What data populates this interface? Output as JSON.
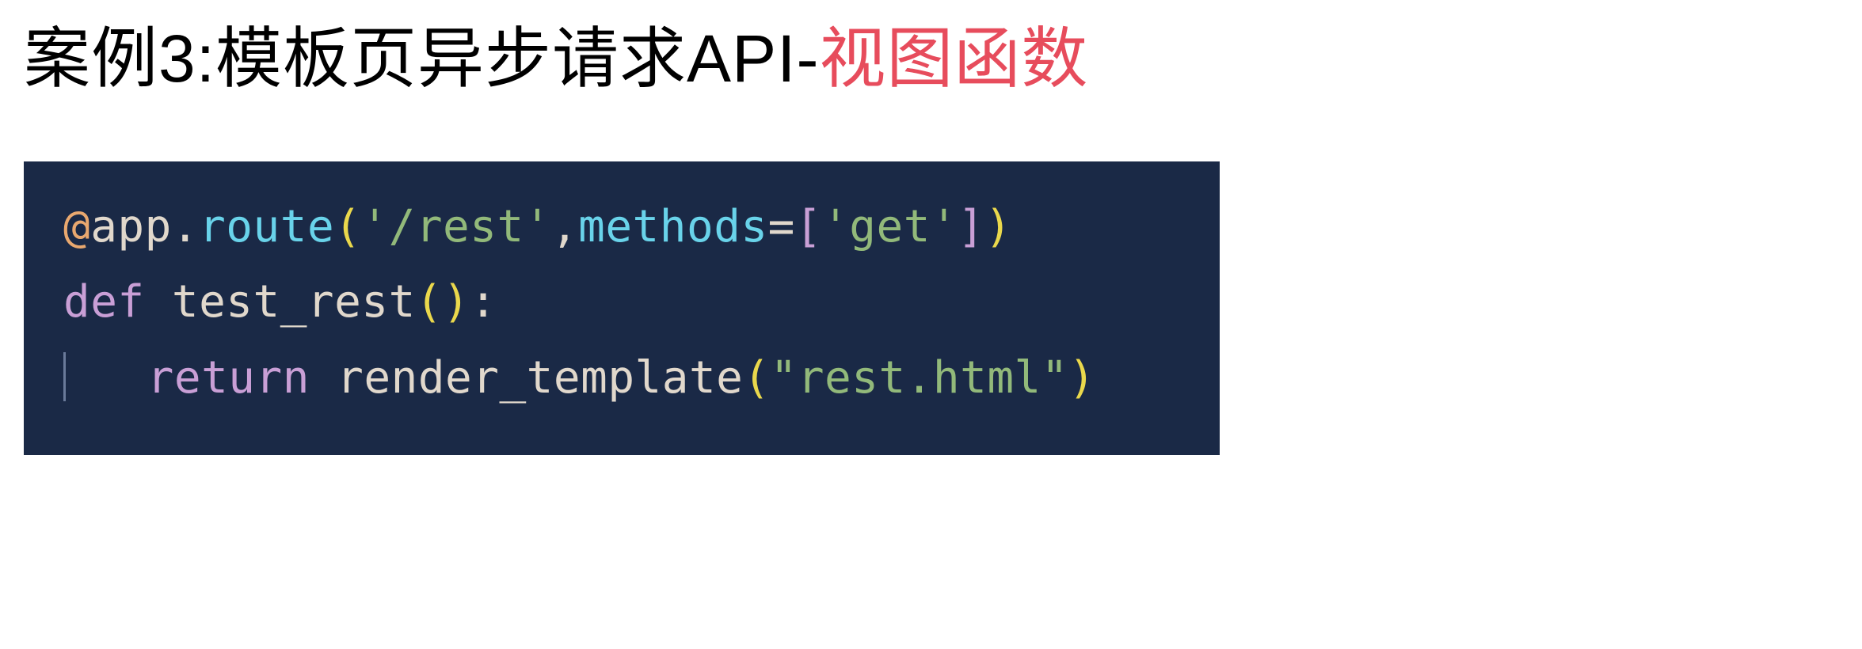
{
  "heading": {
    "prefix": "案例3:模板页异步请求API-",
    "highlight": "视图函数"
  },
  "code": {
    "line1": {
      "at": "@",
      "app": "app",
      "dot": ".",
      "route": "route",
      "lparen": "(",
      "path": "'/rest'",
      "comma": ",",
      "methods_kw": "methods",
      "equals": "=",
      "lbracket": "[",
      "method_val": "'get'",
      "rbracket": "]",
      "rparen": ")"
    },
    "line2": {
      "def": "def ",
      "name": "test_rest",
      "parens": "()",
      "colon": ":"
    },
    "line3": {
      "indent_spaces": "   ",
      "ret": "return ",
      "func": "render_template",
      "lparen": "(",
      "arg": "\"rest.html\"",
      "rparen": ")"
    }
  }
}
